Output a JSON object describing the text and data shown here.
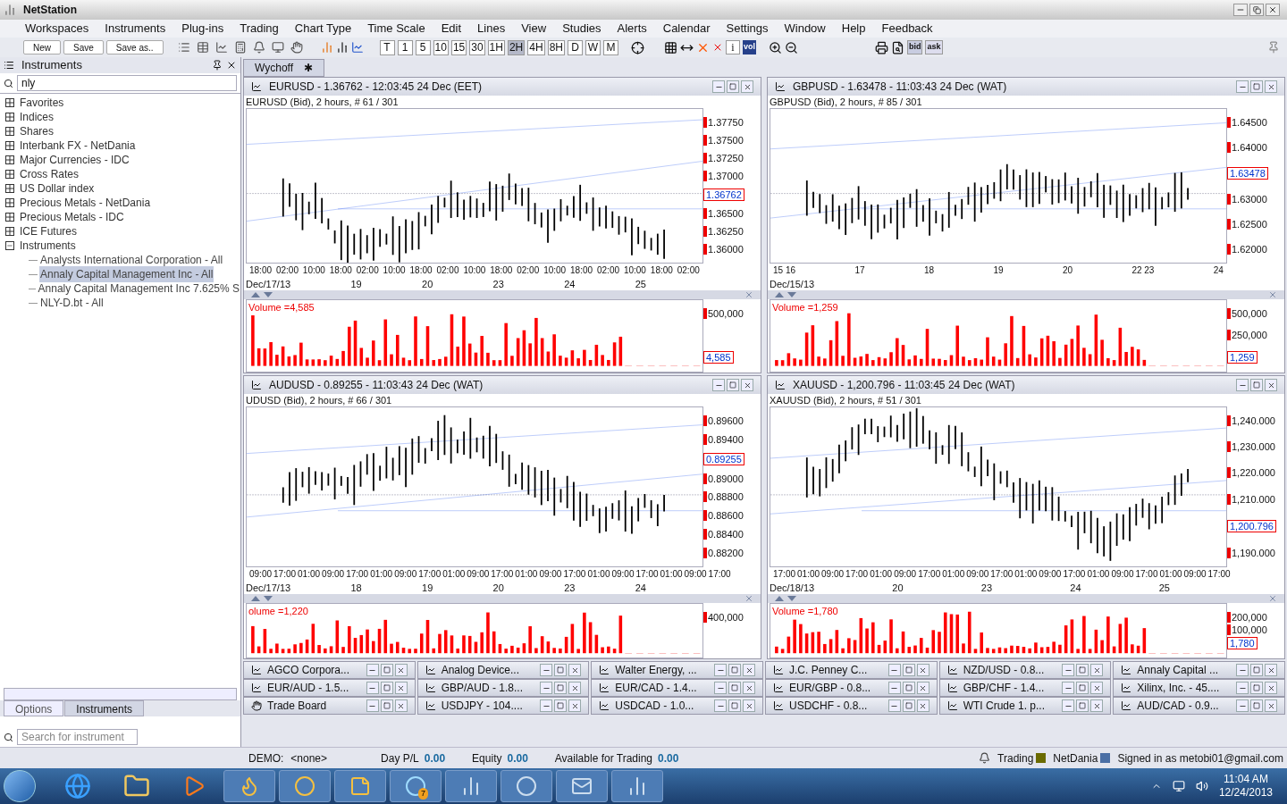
{
  "window": {
    "title": "NetStation"
  },
  "menu": [
    "Workspaces",
    "Instruments",
    "Plug-ins",
    "Trading",
    "Chart Type",
    "Time Scale",
    "Edit",
    "Lines",
    "View",
    "Studies",
    "Alerts",
    "Calendar",
    "Settings",
    "Window",
    "Help",
    "Feedback"
  ],
  "toolbar": {
    "buttons": [
      "New",
      "Save",
      "Save as.."
    ],
    "time_scales": [
      {
        "label": "T",
        "selected": false
      },
      {
        "label": "1",
        "selected": false
      },
      {
        "label": "5",
        "selected": false
      },
      {
        "label": "10",
        "selected": false
      },
      {
        "label": "15",
        "selected": false
      },
      {
        "label": "30",
        "selected": false
      },
      {
        "label": "1H",
        "selected": false
      },
      {
        "label": "2H",
        "selected": true
      },
      {
        "label": "4H",
        "selected": false
      },
      {
        "label": "8H",
        "selected": false
      },
      {
        "label": "D",
        "selected": false
      },
      {
        "label": "W",
        "selected": false
      },
      {
        "label": "M",
        "selected": false
      }
    ],
    "info_label": "i",
    "vol_label": "vol",
    "bid_label": "bid",
    "ask_label": "ask"
  },
  "sidebar": {
    "title": "Instruments",
    "search": "nly",
    "tree": [
      {
        "label": "Favorites",
        "expanded": false
      },
      {
        "label": "Indices",
        "expanded": false
      },
      {
        "label": "Shares",
        "expanded": false
      },
      {
        "label": "Interbank FX - NetDania",
        "expanded": false
      },
      {
        "label": "Major Currencies - IDC",
        "expanded": false
      },
      {
        "label": "Cross Rates",
        "expanded": false
      },
      {
        "label": "US Dollar index",
        "expanded": false
      },
      {
        "label": "Precious Metals - NetDania",
        "expanded": false
      },
      {
        "label": "Precious Metals - IDC",
        "expanded": false
      },
      {
        "label": "ICE Futures",
        "expanded": false
      },
      {
        "label": "Instruments",
        "expanded": true,
        "children": [
          {
            "label": "Analysts International Corporation  - All",
            "selected": false
          },
          {
            "label": "Annaly Capital Management Inc - All",
            "selected": true
          },
          {
            "label": "Annaly Capital Management Inc 7.625% S",
            "selected": false
          },
          {
            "label": "NLY-D.bt - All",
            "selected": false
          }
        ]
      }
    ],
    "tabs": [
      {
        "label": "Options",
        "selected": false
      },
      {
        "label": "Instruments",
        "selected": true
      }
    ],
    "search_placeholder": "Search for instrument"
  },
  "workspace_tab": {
    "label": "Wychoff",
    "close": "✱"
  },
  "charts": [
    {
      "title": "EURUSD - 1.36762 - 12:03:45  24 Dec (EET)",
      "subtitle": "EURUSD (Bid), 2 hours, # 61 / 301",
      "yticks": [
        {
          "kind": "tick",
          "label": "1.37750"
        },
        {
          "kind": "tick",
          "label": "1.37500"
        },
        {
          "kind": "tick",
          "label": "1.37250"
        },
        {
          "kind": "tick",
          "label": "1.37000"
        },
        {
          "kind": "price",
          "label": "1.36762"
        },
        {
          "kind": "tick",
          "label": "1.36500"
        },
        {
          "kind": "tick",
          "label": "1.36250"
        },
        {
          "kind": "tick",
          "label": "1.36000"
        }
      ],
      "times": [
        "18:00",
        "02:00",
        "10:00",
        "18:00",
        "02:00",
        "10:00",
        "18:00",
        "02:00",
        "10:00",
        "18:00",
        "02:00",
        "10:00",
        "18:00",
        "02:00",
        "10:00",
        "18:00",
        "02:00"
      ],
      "dates": [
        "Dec/17/13",
        "19",
        "20",
        "23",
        "24",
        "25"
      ],
      "volume": {
        "label": "Volume =4,585",
        "yticks": [
          {
            "kind": "tick",
            "label": "500,000"
          },
          {
            "kind": "price",
            "label": "4,585"
          }
        ]
      }
    },
    {
      "title": "GBPUSD - 1.63478 - 11:03:43  24 Dec (WAT)",
      "subtitle": "GBPUSD (Bid), 2 hours, # 85 / 301",
      "yticks": [
        {
          "kind": "tick",
          "label": "1.64500"
        },
        {
          "kind": "tick",
          "label": "1.64000"
        },
        {
          "kind": "price",
          "label": "1.63478"
        },
        {
          "kind": "tick",
          "label": "1.63000"
        },
        {
          "kind": "tick",
          "label": "1.62500"
        },
        {
          "kind": "tick",
          "label": "1.62000"
        }
      ],
      "times": [
        "15 16",
        "17",
        "18",
        "19",
        "20",
        "22 23",
        "24"
      ],
      "dates": [
        "Dec/15/13"
      ],
      "volume": {
        "label": "Volume =1,259",
        "yticks": [
          {
            "kind": "tick",
            "label": "500,000"
          },
          {
            "kind": "tick",
            "label": "250,000"
          },
          {
            "kind": "price",
            "label": "1,259"
          }
        ]
      }
    },
    {
      "title": "AUDUSD - 0.89255 - 11:03:43  24 Dec (WAT)",
      "subtitle": "UDUSD (Bid), 2 hours, # 66 / 301",
      "yticks": [
        {
          "kind": "tick",
          "label": "0.89600"
        },
        {
          "kind": "tick",
          "label": "0.89400"
        },
        {
          "kind": "price",
          "label": "0.89255"
        },
        {
          "kind": "tick",
          "label": "0.89000"
        },
        {
          "kind": "tick",
          "label": "0.88800"
        },
        {
          "kind": "tick",
          "label": "0.88600"
        },
        {
          "kind": "tick",
          "label": "0.88400"
        },
        {
          "kind": "tick",
          "label": "0.88200"
        }
      ],
      "times": [
        "09:00",
        "17:00",
        "01:00",
        "09:00",
        "17:00",
        "01:00",
        "09:00",
        "17:00",
        "01:00",
        "09:00",
        "17:00",
        "01:00",
        "09:00",
        "17:00",
        "01:00",
        "09:00",
        "17:00",
        "01:00",
        "09:00",
        "17:00"
      ],
      "dates": [
        "Dec/17/13",
        "18",
        "19",
        "20",
        "23",
        "24"
      ],
      "volume": {
        "label": "olume =1,220",
        "yticks": [
          {
            "kind": "tick",
            "label": "400,000"
          }
        ]
      }
    },
    {
      "title": "XAUUSD - 1,200.796 - 11:03:45  24 Dec (WAT)",
      "subtitle": "XAUUSD (Bid), 2 hours, # 51 / 301",
      "yticks": [
        {
          "kind": "tick",
          "label": "1,240.000"
        },
        {
          "kind": "tick",
          "label": "1,230.000"
        },
        {
          "kind": "tick",
          "label": "1,220.000"
        },
        {
          "kind": "tick",
          "label": "1,210.000"
        },
        {
          "kind": "price",
          "label": "1,200.796"
        },
        {
          "kind": "tick",
          "label": "1,190.000"
        }
      ],
      "times": [
        "17:00",
        "01:00",
        "09:00",
        "17:00",
        "01:00",
        "09:00",
        "17:00",
        "01:00",
        "09:00",
        "17:00",
        "01:00",
        "09:00",
        "17:00",
        "01:00",
        "09:00",
        "17:00",
        "01:00",
        "09:00",
        "17:00"
      ],
      "dates": [
        "Dec/18/13",
        "20",
        "23",
        "24",
        "25"
      ],
      "volume": {
        "label": "Volume =1,780",
        "yticks": [
          {
            "kind": "tick",
            "label": "200,000"
          },
          {
            "kind": "tick",
            "label": "100,000"
          },
          {
            "kind": "price",
            "label": "1,780"
          }
        ]
      }
    }
  ],
  "minimized": [
    {
      "label": "AGCO Corpora...",
      "kind": "chart"
    },
    {
      "label": "Analog Device...",
      "kind": "chart"
    },
    {
      "label": "Walter Energy, ...",
      "kind": "chart"
    },
    {
      "label": "J.C. Penney C...",
      "kind": "chart"
    },
    {
      "label": "NZD/USD - 0.8...",
      "kind": "chart"
    },
    {
      "label": "Annaly Capital ...",
      "kind": "chart"
    },
    {
      "label": "EUR/AUD - 1.5...",
      "kind": "chart"
    },
    {
      "label": "GBP/AUD - 1.8...",
      "kind": "chart"
    },
    {
      "label": "EUR/CAD - 1.4...",
      "kind": "chart"
    },
    {
      "label": "EUR/GBP - 0.8...",
      "kind": "chart"
    },
    {
      "label": "GBP/CHF - 1.4...",
      "kind": "chart"
    },
    {
      "label": "Xilinx, Inc.  - 45....",
      "kind": "chart"
    },
    {
      "label": "Trade Board",
      "kind": "board"
    },
    {
      "label": "USDJPY - 104....",
      "kind": "chart"
    },
    {
      "label": "USDCAD - 1.0...",
      "kind": "chart"
    },
    {
      "label": "USDCHF - 0.8...",
      "kind": "chart"
    },
    {
      "label": "WTI Crude 1. p...",
      "kind": "chart"
    },
    {
      "label": "AUD/CAD - 0.9...",
      "kind": "chart"
    }
  ],
  "status_bar": {
    "account_label": "DEMO:",
    "account": "<none>",
    "fields": [
      {
        "label": "Day P/L",
        "value": "0.00"
      },
      {
        "label": "Equity",
        "value": "0.00"
      },
      {
        "label": "Available for Trading",
        "value": "0.00"
      }
    ],
    "indicators": [
      {
        "label": "Trading",
        "color": "#6b6b00"
      },
      {
        "label": "NetDania",
        "color": "#4a6fa5"
      }
    ],
    "signed_in": "Signed in as metobi01@gmail.com"
  },
  "taskbar": {
    "skype_badge": "7",
    "time": "11:04 AM",
    "date": "12/24/2013"
  }
}
